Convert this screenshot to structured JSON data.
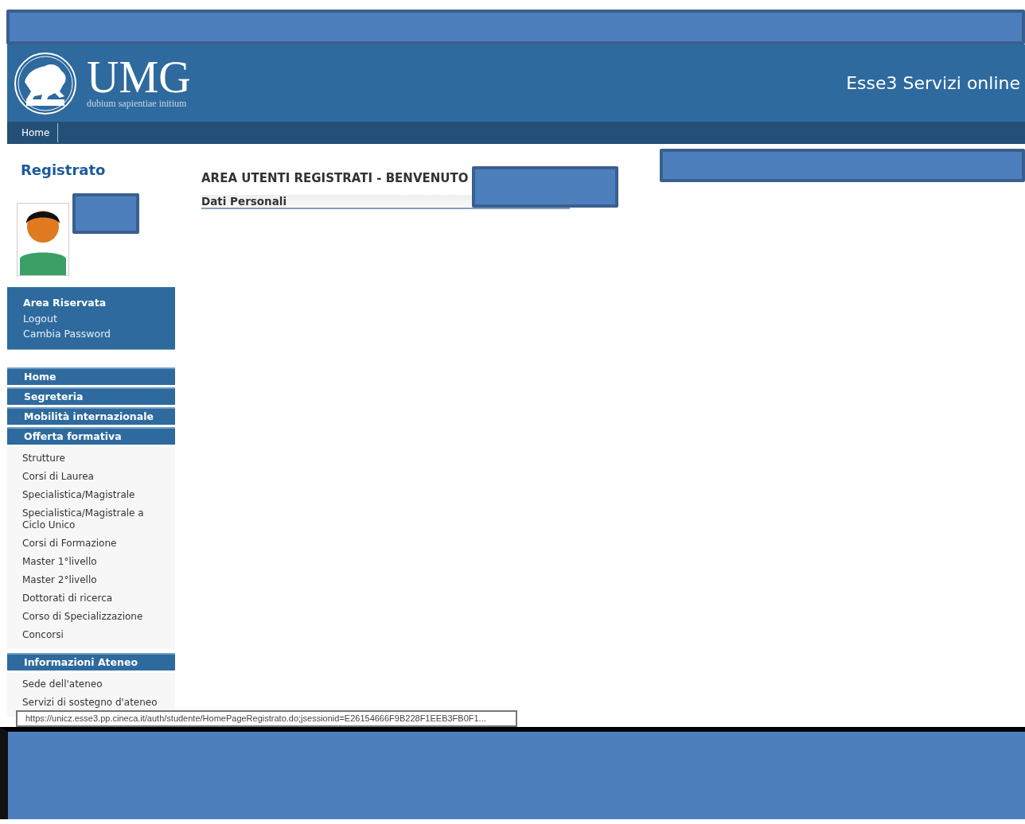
{
  "header": {
    "logo_title": "UMG",
    "logo_motto": "dubium sapientiae initium",
    "app_title": "Esse3 Servizi online"
  },
  "nav": [
    {
      "label": "Home"
    }
  ],
  "sidebar": {
    "role": "Registrato",
    "user_links": [
      {
        "label": "Area Riservata",
        "kind": "heading"
      },
      {
        "label": "Logout",
        "kind": "link"
      },
      {
        "label": "Cambia Password",
        "kind": "link"
      }
    ],
    "menu": [
      {
        "label": "Home"
      },
      {
        "label": "Segreteria"
      },
      {
        "label": "Mobilità internazionale"
      },
      {
        "label": "Offerta formativa",
        "children": [
          {
            "label": "Strutture"
          },
          {
            "label": "Corsi di Laurea"
          },
          {
            "label": "Specialistica/Magistrale"
          },
          {
            "label": "Specialistica/Magistrale a Ciclo Unico"
          },
          {
            "label": "Corsi di Formazione"
          },
          {
            "label": "Master 1°livello"
          },
          {
            "label": "Master 2°livello"
          },
          {
            "label": "Dottorati di ricerca"
          },
          {
            "label": "Corso di Specializzazione"
          },
          {
            "label": "Concorsi"
          }
        ]
      },
      {
        "label": "Informazioni Ateneo",
        "children": [
          {
            "label": "Sede dell'ateneo"
          },
          {
            "label": "Servizi di sostegno d'ateneo"
          }
        ]
      }
    ]
  },
  "main": {
    "title": "AREA UTENTI REGISTRATI - BENVENUTO",
    "sections": [
      {
        "label": "Dati Personali"
      }
    ]
  },
  "status_url": "https://unicz.esse3.pp.cineca.it/auth/studente/HomePageRegistrato.do;jsessionid=E26154666F9B228F1EEB3FB0F1..."
}
